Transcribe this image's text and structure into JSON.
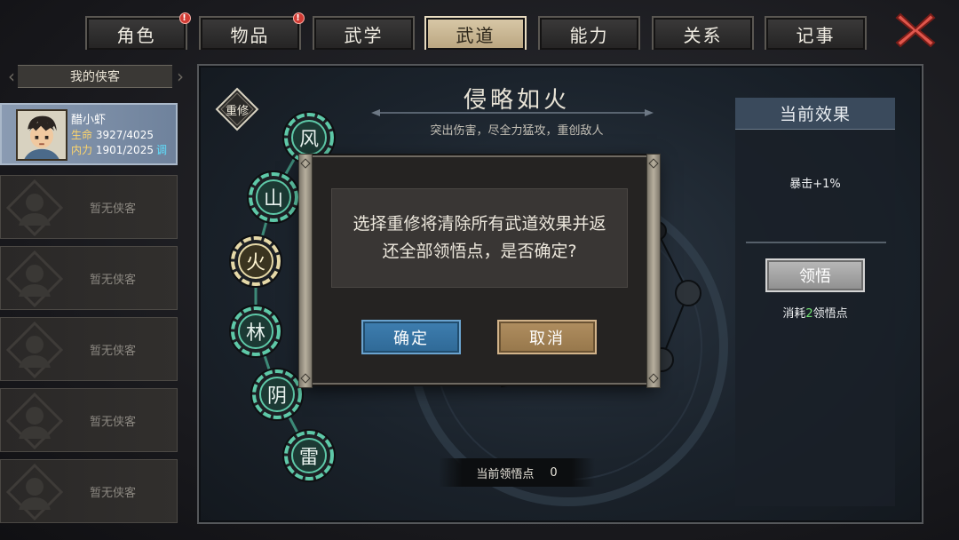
{
  "tabs": [
    {
      "label": "角色",
      "alert": "!"
    },
    {
      "label": "物品",
      "alert": "!"
    },
    {
      "label": "武学"
    },
    {
      "label": "武道",
      "active": true
    },
    {
      "label": "能力"
    },
    {
      "label": "关系"
    },
    {
      "label": "记事"
    }
  ],
  "roster": {
    "title": "我的侠客",
    "hero": {
      "name": "醋小虾",
      "hp_label": "生命",
      "hp_value": "3927/4025",
      "mp_label": "内力",
      "mp_value": "1901/2025",
      "adjust_label": "调"
    },
    "empty_label": "暂无侠客",
    "empty_count": 5
  },
  "main": {
    "rebuild_label": "重修",
    "title": "侵略如火",
    "description": "突出伤害，尽全力猛攻，重创敌人",
    "nodes": [
      "风",
      "山",
      "火",
      "林",
      "阴",
      "雷"
    ],
    "selected_node": "火",
    "points_label": "当前领悟点",
    "points_value": "0"
  },
  "effect": {
    "header": "当前效果",
    "text": "暴击+1%",
    "button": "领悟",
    "cost_prefix": "消耗",
    "cost_value": "2",
    "cost_suffix": "领悟点"
  },
  "dialog": {
    "message": "选择重修将清除所有武道效果并返还全部领悟点，是否确定?",
    "confirm": "确定",
    "cancel": "取消"
  },
  "colors": {
    "accent_teal": "#5ec9a8",
    "active_tab": "#d9c9a8",
    "confirm_blue": "#3e7eb0",
    "cancel_tan": "#b08e60",
    "alert_red": "#d13b34"
  }
}
